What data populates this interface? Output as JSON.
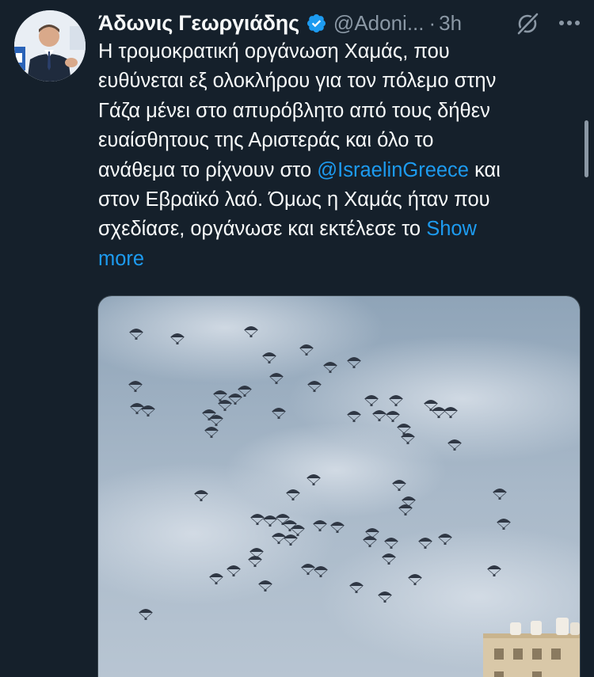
{
  "author": {
    "name": "Άδωνις Γεωργιάδης",
    "handle": "@Adoni...",
    "separator": "·",
    "time": "3h",
    "verified": true
  },
  "tweet": {
    "lines": [
      "Η τρομοκρατική οργάνωση Χαμάς, που",
      "ευθύνεται εξ ολοκλήρου για τον πόλεμο στην",
      "Γάζα μένει στο απυρόβλητο από τους δήθεν",
      "ευαίσθητους της Αριστεράς και όλο το"
    ],
    "line5_pre": "ανάθεμα το ρίχνουν στο ",
    "mention": "@IsraelinGreece",
    "line5_post": " και",
    "line6": "στον Εβραϊκό λαό. Όμως η Χαμάς ήταν που",
    "line7_pre": "σχεδίασε, οργάνωσε και εκτέλεσε το ",
    "show_more": "Show",
    "show_more_2": "more"
  },
  "media": {
    "description_icon": "parachute-airdrop-photo"
  },
  "icons": {
    "verified": "verified-badge-icon",
    "grok": "grok-icon",
    "more": "more-options-icon"
  },
  "colors": {
    "background": "#15202b",
    "text": "#f7f9f9",
    "secondary": "#8b98a5",
    "link": "#1d9bf0"
  }
}
